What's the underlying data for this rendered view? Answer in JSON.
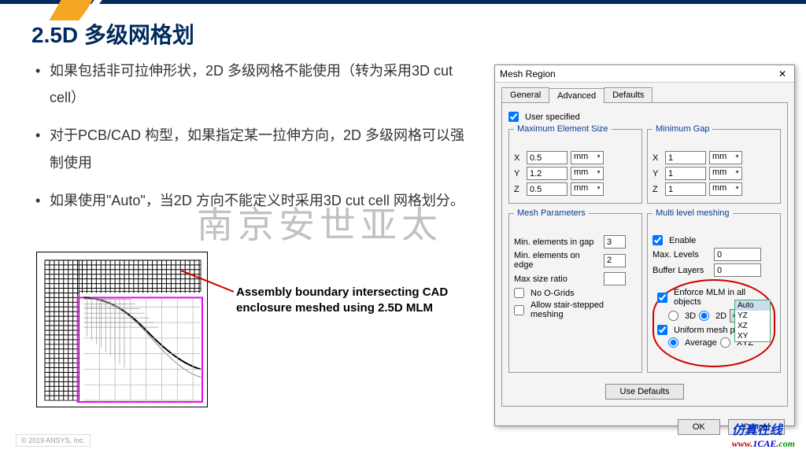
{
  "title": "2.5D 多级网格划",
  "bullets": [
    "如果包括非可拉伸形状，2D 多级网格不能使用（转为采用3D cut cell）",
    "对于PCB/CAD 构型，如果指定某一拉伸方向，2D 多级网格可以强制使用",
    "如果使用\"Auto\"，当2D 方向不能定义时采用3D cut cell 网格划分。"
  ],
  "callout": "Assembly boundary intersecting CAD enclosure meshed using 2.5D MLM",
  "watermark": "南京安世亚太",
  "dialog": {
    "title": "Mesh Region",
    "tabs": [
      "General",
      "Advanced",
      "Defaults"
    ],
    "user_spec": "User specified",
    "max_elem": {
      "title": "Maximum Element Size",
      "x": "0.5",
      "y": "1.2",
      "z": "0.5",
      "unit": "mm"
    },
    "min_gap": {
      "title": "Minimum Gap",
      "x": "1",
      "y": "1",
      "z": "1",
      "unit": "mm"
    },
    "mesh_params": {
      "title": "Mesh Parameters",
      "min_gap_lbl": "Min. elements in gap",
      "min_gap_v": "3",
      "min_edge_lbl": "Min. elements on edge",
      "min_edge_v": "2",
      "max_ratio_lbl": "Max size ratio",
      "max_ratio_v": "",
      "no_ogrids": "No O-Grids",
      "stair": "Allow stair-stepped meshing"
    },
    "mlm": {
      "title": "Multi level meshing",
      "enable": "Enable",
      "max_levels_lbl": "Max. Levels",
      "max_levels_v": "0",
      "buffer_lbl": "Buffer Layers",
      "buffer_v": "0",
      "enforce": "Enforce MLM in all objects",
      "r3d": "3D",
      "r2d": "2D",
      "dd_value": "Auto",
      "uniform": "Uniform mesh params",
      "avg": "Average",
      "xyz": "XYZ",
      "options": [
        "Auto",
        "YZ",
        "XZ",
        "XY"
      ]
    },
    "use_defaults": "Use Defaults",
    "ok": "OK",
    "cancel": "Cancel"
  },
  "footer": {
    "copy": "© 2019 ANSYS, Inc.",
    "cn": "仿真在线",
    "url_parts": [
      "www.",
      "1CAE",
      ".",
      "com"
    ]
  }
}
